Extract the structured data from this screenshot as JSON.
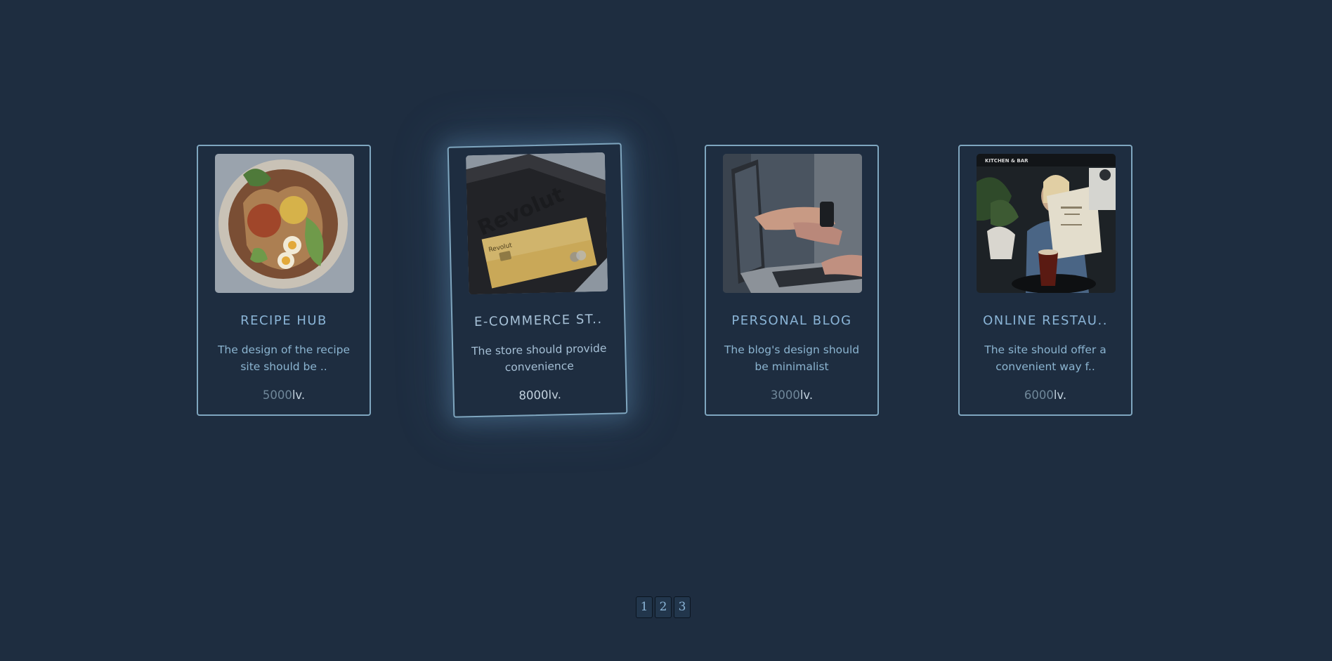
{
  "cards": [
    {
      "title": "RECIPE HUB",
      "description": "The design of the recipe site should be ..",
      "price_value": "5000",
      "price_currency": "lv.",
      "image": "ramen-bowl-photo"
    },
    {
      "title": "E-COMMERCE ST..",
      "description": "The store should provide convenience",
      "price_value": "8000",
      "price_currency": "lv.",
      "image": "revolut-gold-card-photo"
    },
    {
      "title": "PERSONAL BLOG",
      "description": "The blog's design should be minimalist",
      "price_value": "3000",
      "price_currency": "lv.",
      "image": "laptop-pointing-photo"
    },
    {
      "title": "ONLINE RESTAU..",
      "description": "The site should offer a convenient way f..",
      "price_value": "6000",
      "price_currency": "lv.",
      "image": "restaurant-menu-photo"
    }
  ],
  "image_text": {
    "revolut_box": "Revolut",
    "revolut_card": "Revolut",
    "cafe_sign": "KITCHEN & BAR"
  },
  "pagination": {
    "pages": [
      "1",
      "2",
      "3"
    ]
  },
  "colors": {
    "background": "#1e2d40",
    "card_border": "#7fa6bf",
    "title": "#8ab4d6",
    "price_muted": "#6f8799"
  }
}
